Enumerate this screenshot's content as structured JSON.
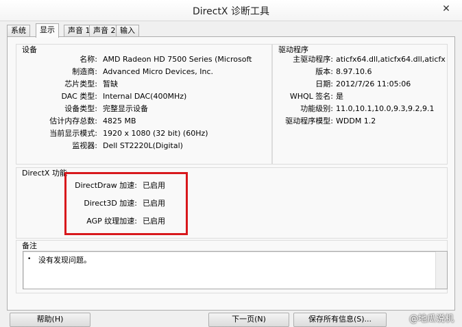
{
  "window": {
    "title": "DirectX 诊断工具",
    "close_glyph": "✕"
  },
  "tabs": [
    {
      "label": "系统"
    },
    {
      "label": "显示"
    },
    {
      "label": "声音 1"
    },
    {
      "label": "声音 2"
    },
    {
      "label": "输入"
    }
  ],
  "device": {
    "title": "设备",
    "rows": [
      {
        "label": "名称:",
        "value": "AMD Radeon HD 7500 Series (Microsoft"
      },
      {
        "label": "制造商:",
        "value": "Advanced Micro Devices, Inc."
      },
      {
        "label": "芯片类型:",
        "value": "暂缺"
      },
      {
        "label": "DAC 类型:",
        "value": "Internal DAC(400MHz)"
      },
      {
        "label": "设备类型:",
        "value": "完整显示设备"
      },
      {
        "label": "估计内存总数:",
        "value": "4825 MB"
      },
      {
        "label": "当前显示模式:",
        "value": "1920 x 1080 (32 bit) (60Hz)"
      },
      {
        "label": "监视器:",
        "value": "Dell ST2220L(Digital)"
      }
    ]
  },
  "driver": {
    "title": "驱动程序",
    "rows": [
      {
        "label": "主驱动程序:",
        "value": "aticfx64.dll,aticfx64.dll,aticfx64.dll,ati"
      },
      {
        "label": "版本:",
        "value": "8.97.10.6"
      },
      {
        "label": "日期:",
        "value": "2012/7/26 11:05:06"
      },
      {
        "label": "WHQL 签名:",
        "value": "是"
      },
      {
        "label": "功能级别:",
        "value": "11.0,10.1,10.0,9.3,9.2,9.1"
      },
      {
        "label": "驱动程序模型:",
        "value": "WDDM 1.2"
      }
    ]
  },
  "directx_features": {
    "title": "DirectX 功能",
    "rows": [
      {
        "label": "DirectDraw 加速:",
        "value": "已启用"
      },
      {
        "label": "Direct3D 加速:",
        "value": "已启用"
      },
      {
        "label": "AGP 纹理加速:",
        "value": "已启用"
      }
    ]
  },
  "notes": {
    "title": "备注",
    "bullet": "•",
    "items": [
      "没有发现问题。"
    ]
  },
  "buttons": {
    "help": "帮助(H)",
    "next": "下一页(N)",
    "save": "保存所有信息(S)..."
  },
  "watermark": "@地瓜说机",
  "colors": {
    "highlight": "#d8181c"
  }
}
